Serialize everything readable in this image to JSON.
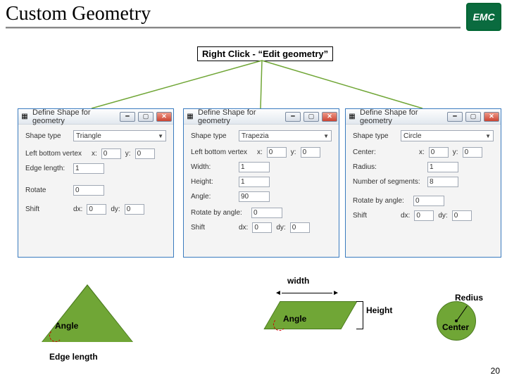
{
  "header": {
    "title": "Custom Geometry",
    "logo_text": "EMC"
  },
  "instruction": "Right Click - “Edit geometry”",
  "dialogs": {
    "triangle": {
      "title": "Define Shape for geometry",
      "shape_type_label": "Shape type",
      "shape_type_value": "Triangle",
      "vertex_label": "Left bottom vertex",
      "x_label": "x:",
      "x_value": "0",
      "y_label": "y:",
      "y_value": "0",
      "edge_label": "Edge length:",
      "edge_value": "1",
      "rotate_label": "Rotate",
      "rotate_value": "0",
      "shift_label": "Shift",
      "dx_label": "dx:",
      "dx_value": "0",
      "dy_label": "dy:",
      "dy_value": "0"
    },
    "trapezia": {
      "title": "Define Shape for geometry",
      "shape_type_label": "Shape type",
      "shape_type_value": "Trapezia",
      "vertex_label": "Left bottom vertex",
      "x_label": "x:",
      "x_value": "0",
      "y_label": "y:",
      "y_value": "0",
      "width_label": "Width:",
      "width_value": "1",
      "height_label": "Height:",
      "height_value": "1",
      "angle_label": "Angle:",
      "angle_value": "90",
      "rotate_label": "Rotate by angle:",
      "rotate_value": "0",
      "shift_label": "Shift",
      "dx_label": "dx:",
      "dx_value": "0",
      "dy_label": "dy:",
      "dy_value": "0"
    },
    "circle": {
      "title": "Define Shape for geometry",
      "shape_type_label": "Shape type",
      "shape_type_value": "Circle",
      "center_label": "Center:",
      "x_label": "x:",
      "x_value": "0",
      "y_label": "y:",
      "y_value": "0",
      "radius_label": "Radius:",
      "radius_value": "1",
      "segments_label": "Number of segments:",
      "segments_value": "8",
      "rotate_label": "Rotate by angle:",
      "rotate_value": "0",
      "shift_label": "Shift",
      "dx_label": "dx:",
      "dx_value": "0",
      "dy_label": "dy:",
      "dy_value": "0"
    }
  },
  "diagram": {
    "triangle": {
      "angle": "Angle",
      "edge": "Edge length"
    },
    "trapezia": {
      "width": "width",
      "height": "Height",
      "angle": "Angle"
    },
    "circle": {
      "radius": "Redius",
      "center": "Center"
    }
  },
  "slide_number": "20"
}
